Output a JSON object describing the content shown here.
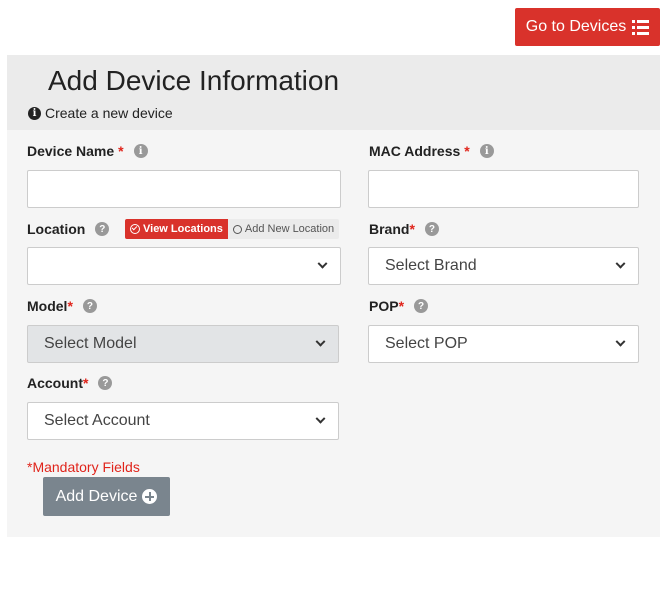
{
  "header": {
    "goto_devices_label": "Go to Devices",
    "title": "Add Device Information",
    "subtitle": "Create a new device"
  },
  "form": {
    "device_name": {
      "label": "Device Name",
      "required_mark": "*",
      "value": ""
    },
    "mac_address": {
      "label": "MAC Address",
      "required_mark": "*",
      "value": ""
    },
    "location": {
      "label": "Location",
      "view_locations_label": "View Locations",
      "add_new_location_label": "Add New Location",
      "selected": ""
    },
    "brand": {
      "label": "Brand",
      "required_mark": "*",
      "selected": "Select Brand"
    },
    "model": {
      "label": "Model",
      "required_mark": "*",
      "selected": "Select Model",
      "disabled": true
    },
    "pop": {
      "label": "POP",
      "required_mark": "*",
      "selected": "Select POP"
    },
    "account": {
      "label": "Account",
      "required_mark": "*",
      "selected": "Select Account"
    }
  },
  "footer": {
    "mandatory_note": "*Mandatory Fields",
    "add_device_label": "Add Device"
  },
  "colors": {
    "primary_red": "#d9322b",
    "required_red": "#e0241b",
    "button_grey": "#7a858e",
    "panel_bg": "#f5f5f5",
    "header_bg": "#ebebeb"
  }
}
